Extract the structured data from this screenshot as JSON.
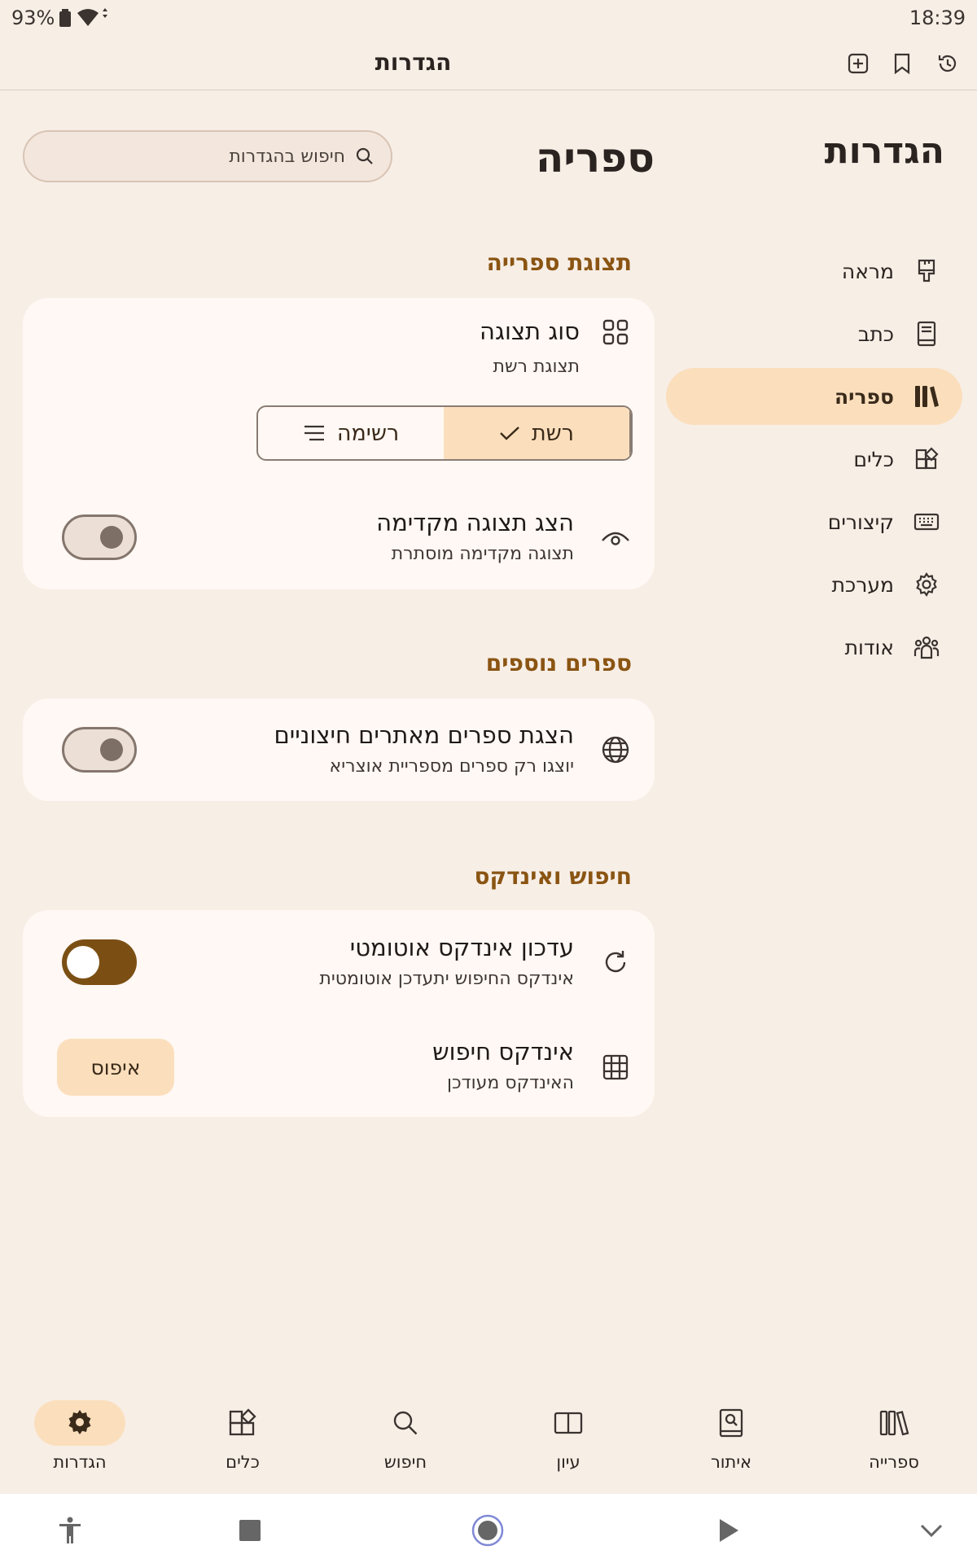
{
  "status": {
    "time": "18:39",
    "battery": "93%"
  },
  "appbar": {
    "title": "הגדרות"
  },
  "page": {
    "title": "הגדרות",
    "section_title": "ספריה",
    "search_placeholder": "חיפוש בהגדרות"
  },
  "nav": {
    "items": [
      {
        "label": "מראה",
        "icon": "paintbrush-icon"
      },
      {
        "label": "כתב",
        "icon": "book-icon"
      },
      {
        "label": "ספריה",
        "icon": "library-icon",
        "active": true
      },
      {
        "label": "כלים",
        "icon": "widgets-icon"
      },
      {
        "label": "קיצורים",
        "icon": "keyboard-icon"
      },
      {
        "label": "מערכת",
        "icon": "gear-icon"
      },
      {
        "label": "אודות",
        "icon": "people-icon"
      }
    ]
  },
  "sections": {
    "display": {
      "header": "תצוגת ספרייה",
      "view_type_title": "סוג תצוגה",
      "view_type_sub": "תצוגת רשת",
      "grid_label": "רשת",
      "list_label": "רשימה",
      "preview_title": "הצג תצוגה מקדימה",
      "preview_sub": "תצוגה מקדימה מוסתרת",
      "preview_on": false
    },
    "extra": {
      "header": "ספרים נוספים",
      "external_title": "הצגת ספרים מאתרים חיצוניים",
      "external_sub": "יוצגו רק ספרים מספריית אוצריא",
      "external_on": false
    },
    "search": {
      "header": "חיפוש ואינדקס",
      "auto_title": "עדכון אינדקס אוטומטי",
      "auto_sub": "אינדקס החיפוש יתעדכן אוטומטית",
      "auto_on": true,
      "index_title": "אינדקס חיפוש",
      "index_sub": "האינדקס מעודכן",
      "reset_label": "איפוס"
    }
  },
  "bottom_nav": {
    "library": "ספרייה",
    "locate": "איתור",
    "study": "עיון",
    "search": "חיפוש",
    "tools": "כלים",
    "settings": "הגדרות"
  },
  "colors": {
    "accent": "#8a5412",
    "selected": "#fbdfbd",
    "background": "#f7eee6",
    "card": "#fff8f4",
    "toggle_on": "#7b4f14"
  }
}
